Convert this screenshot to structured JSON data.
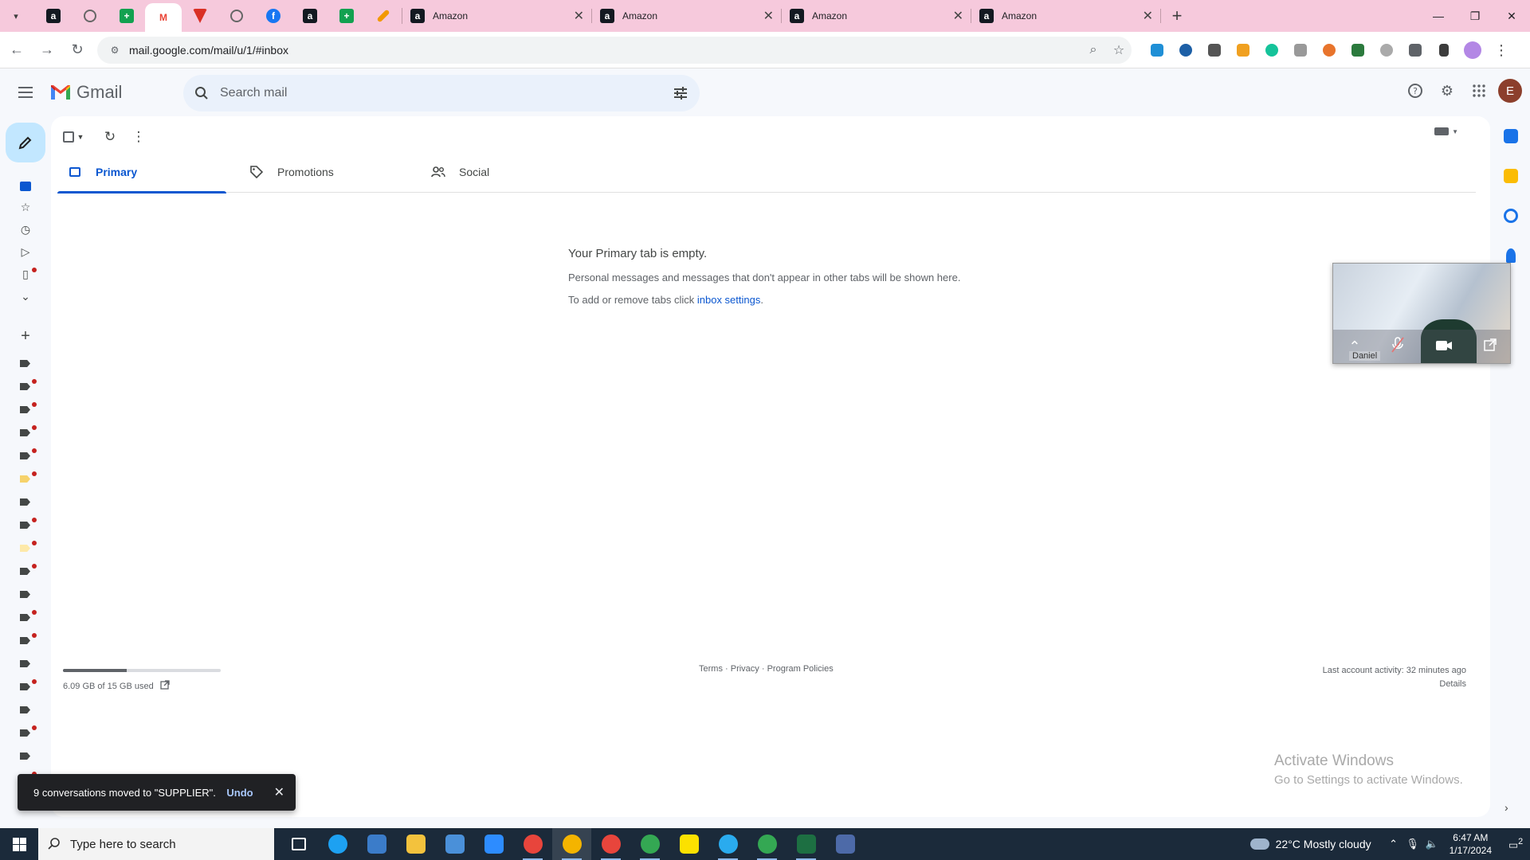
{
  "browser": {
    "tabs": [
      {
        "title": "Amazon"
      },
      {
        "title": "Amazon"
      },
      {
        "title": "Amazon"
      },
      {
        "title": "Amazon"
      }
    ],
    "url": "mail.google.com/mail/u/1/#inbox"
  },
  "gmail": {
    "brand": "Gmail",
    "search_placeholder": "Search mail",
    "avatar_letter": "E",
    "tabs": [
      {
        "label": "Primary"
      },
      {
        "label": "Promotions"
      },
      {
        "label": "Social"
      }
    ],
    "empty": {
      "heading": "Your Primary tab is empty.",
      "line1": "Personal messages and messages that don't appear in other tabs will be shown here.",
      "line2_prefix": "To add or remove tabs click ",
      "line2_link": "inbox settings",
      "line2_suffix": "."
    },
    "storage": {
      "text": "6.09 GB of 15 GB used",
      "used_fraction": 0.406
    },
    "footer": {
      "terms": "Terms",
      "sep1": " · ",
      "privacy": "Privacy",
      "sep2": " · ",
      "policies": "Program Policies",
      "activity": "Last account activity: 32 minutes ago",
      "details": "Details"
    },
    "snackbar": {
      "message": "9 conversations moved to \"SUPPLIER\".",
      "action": "Undo"
    }
  },
  "video_call": {
    "participant": "Daniel"
  },
  "watermark": {
    "line1": "Activate Windows",
    "line2": "Go to Settings to activate Windows."
  },
  "taskbar": {
    "search_placeholder": "Type here to search",
    "weather": "22°C  Mostly cloudy",
    "time": "6:47 AM",
    "date": "1/17/2024",
    "notifications": "2"
  },
  "colors": {
    "tabstrip": "#f6c9dc",
    "gmail_accent": "#0b57d0",
    "compose": "#c2e7ff",
    "search_bg": "#eaf1fb",
    "label_dot": "#c5221f"
  }
}
